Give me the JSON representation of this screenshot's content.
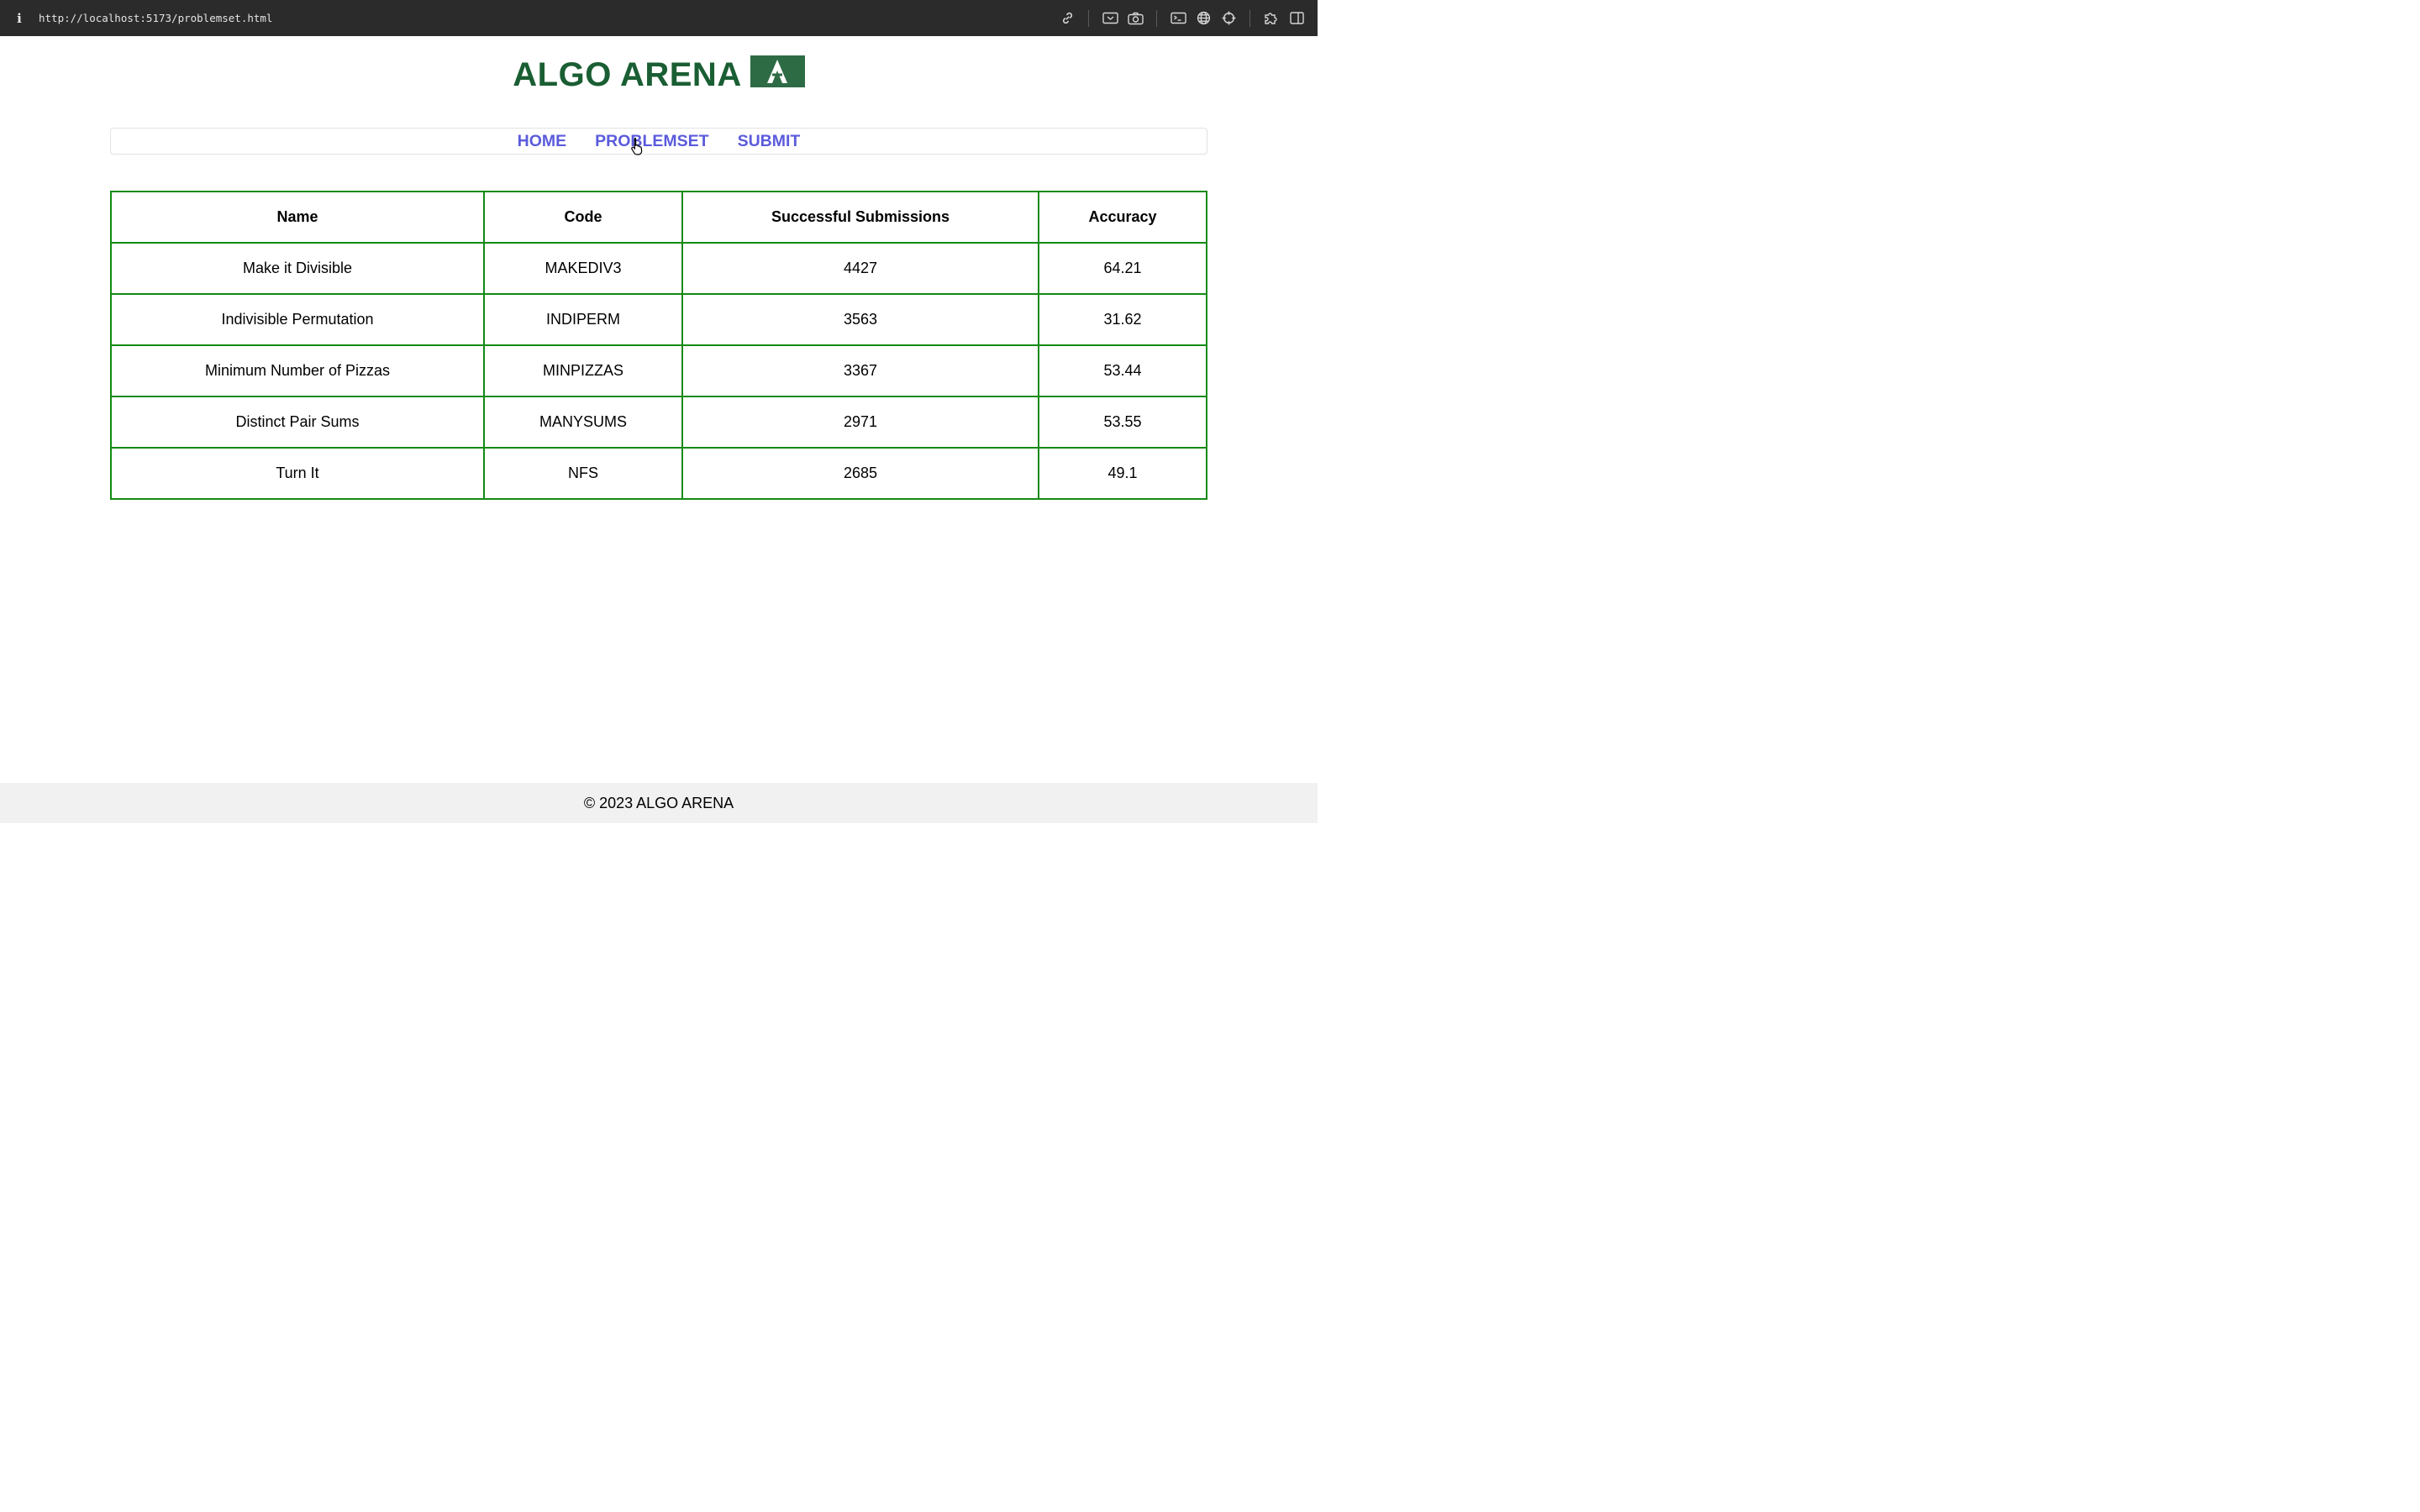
{
  "browser": {
    "info_icon": "i",
    "url": "http://localhost:5173/problemset.html",
    "toolbar_icons": [
      "link-icon",
      "screencast-icon",
      "camera-icon",
      "terminal-icon",
      "globe-icon",
      "crosshair-icon",
      "extensions-icon",
      "sidebar-icon"
    ]
  },
  "header": {
    "logo_text": "ALGO ARENA",
    "logo_badge_letter": "A"
  },
  "nav": {
    "items": [
      {
        "label": "HOME"
      },
      {
        "label": "PROBLEMSET"
      },
      {
        "label": "SUBMIT"
      }
    ]
  },
  "table": {
    "columns": [
      "Name",
      "Code",
      "Successful Submissions",
      "Accuracy"
    ],
    "rows": [
      [
        "Make it Divisible",
        "MAKEDIV3",
        "4427",
        "64.21"
      ],
      [
        "Indivisible Permutation",
        "INDIPERM",
        "3563",
        "31.62"
      ],
      [
        "Minimum Number of Pizzas",
        "MINPIZZAS",
        "3367",
        "53.44"
      ],
      [
        "Distinct Pair Sums",
        "MANYSUMS",
        "2971",
        "53.55"
      ],
      [
        "Turn It",
        "NFS",
        "2685",
        "49.1"
      ]
    ]
  },
  "footer": {
    "text": "© 2023 ALGO ARENA"
  },
  "colors": {
    "brand_green": "#1a5e33",
    "nav_link": "#5b5bdc",
    "table_border": "#138a13",
    "footer_bg": "#f1f1f1"
  }
}
